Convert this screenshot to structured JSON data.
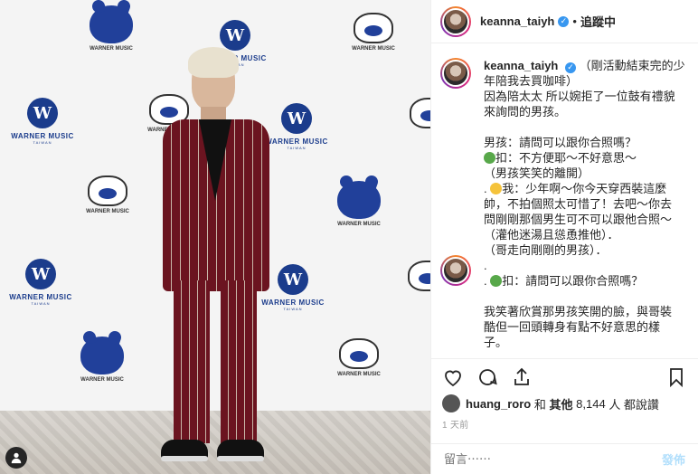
{
  "photo": {
    "brand_label": "WARNER MUSIC",
    "brand_sub": "TAIWAN",
    "mascot_label": "WARNER MUSIC",
    "mascot_sub": "TAIWAN"
  },
  "header": {
    "username": "keanna_taiyh",
    "separator": "•",
    "follow_label": "追蹤中",
    "verified_icon": "verified-badge"
  },
  "caption": {
    "username": "keanna_taiyh",
    "lines": [
      "（剛活動結束完的少",
      "年陪我去買咖啡）",
      "因為陪太太 所以婉拒了一位鼓有禮貌",
      "來詢問的男孩。",
      "",
      "男孩：請問可以跟你合照嗎？",
      "扣：不方便耶～不好意思～",
      "（男孩笑笑的離開）",
      "我：少年啊～你今天穿西裝這麼",
      "帥，不拍個照太可惜了！去吧～你去",
      "問剛剛那個男生可不可以跟他合照～",
      "（灌他迷湯且慫恿推他）．",
      "（哥走向剛剛的男孩）．",
      ".",
      "扣：請問可以跟你合照嗎？",
      "",
      "我笑著欣賞那男孩笑開的臉，與哥裝",
      "酷但一回頭轉身有點不好意思的樣",
      "子。"
    ]
  },
  "likes": {
    "liker": "huang_roro",
    "conjunction": "和",
    "others": "其他",
    "count": "8,144",
    "suffix": "人 都說讚"
  },
  "timestamp": "1 天前",
  "comment_box": {
    "placeholder": "留言⋯⋯",
    "post_label": "發佈"
  },
  "colors": {
    "verified": "#3897f0",
    "post_disabled": "#b2dffc",
    "warner_blue": "#1b3c8c"
  }
}
